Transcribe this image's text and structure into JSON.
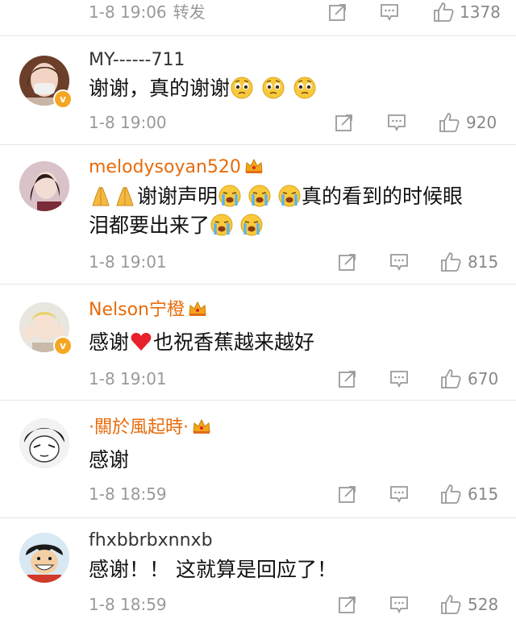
{
  "partial_comment": {
    "time": "1-8 19:06",
    "forward_label": "转发",
    "likes": "1378"
  },
  "comments": [
    {
      "username": "MY------711",
      "vip": false,
      "verified_badge": true,
      "text": "谢谢，真的谢谢",
      "emojis": [
        "pleading-face",
        "pleading-face",
        "pleading-face"
      ],
      "time": "1-8 19:00",
      "likes": "920"
    },
    {
      "username": "melodysoyan520",
      "vip": true,
      "verified_badge": false,
      "text_parts": [
        "谢谢声明",
        "真的看到的时候眼",
        "泪都要出来了"
      ],
      "time": "1-8 19:01",
      "likes": "815"
    },
    {
      "username": "Nelson宁橙",
      "vip": true,
      "verified_badge": true,
      "text_parts": [
        "感谢",
        "也祝香蕉越来越好"
      ],
      "time": "1-8 19:01",
      "likes": "670"
    },
    {
      "username": "·關於風起時·",
      "vip": true,
      "verified_badge": false,
      "text": "感谢",
      "time": "1-8 18:59",
      "likes": "615"
    },
    {
      "username": "fhxbbrbxnnxb",
      "vip": false,
      "verified_badge": false,
      "text": "感谢！！ 这就算是回应了！",
      "time": "1-8 18:59",
      "likes": "528"
    }
  ],
  "colors": {
    "vip_name": "#e86b0a",
    "meta": "#999999",
    "divider": "#e6e6e6"
  }
}
